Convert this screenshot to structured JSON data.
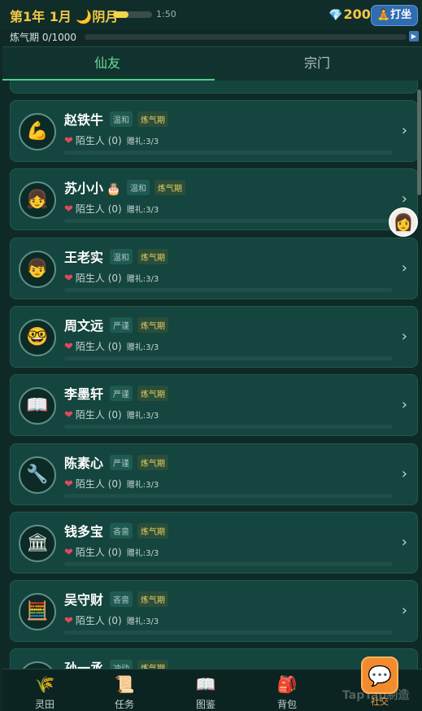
{
  "header": {
    "date": "第1年 1月",
    "moon_icon": "🌙",
    "moon_phase": "阴月",
    "time": "1:50",
    "time_progress": 0.4,
    "gems": "200",
    "gem_icon": "💎",
    "meditate_icon": "🧘",
    "meditate_label": "打坐"
  },
  "cultivation": {
    "label": "炼气期 0/1000",
    "progress": 0
  },
  "tabs": [
    {
      "label": "仙友",
      "active": true
    },
    {
      "label": "宗门",
      "active": false
    }
  ],
  "friends": [
    {
      "name": "赵铁牛",
      "avatar": "💪",
      "temper": "温和",
      "realm": "炼气期",
      "relation": "陌生人 (0)",
      "gift": "赠礼:3/3"
    },
    {
      "name": "苏小小",
      "avatar": "👧",
      "badge": "🎂",
      "temper": "温和",
      "realm": "炼气期",
      "relation": "陌生人 (0)",
      "gift": "赠礼:3/3"
    },
    {
      "name": "王老实",
      "avatar": "👦",
      "temper": "温和",
      "realm": "炼气期",
      "relation": "陌生人 (0)",
      "gift": "赠礼:3/3"
    },
    {
      "name": "周文远",
      "avatar": "🤓",
      "temper": "严谨",
      "realm": "炼气期",
      "relation": "陌生人 (0)",
      "gift": "赠礼:3/3"
    },
    {
      "name": "李墨轩",
      "avatar": "📖",
      "temper": "严谨",
      "realm": "炼气期",
      "relation": "陌生人 (0)",
      "gift": "赠礼:3/3"
    },
    {
      "name": "陈素心",
      "avatar": "🔧",
      "temper": "严谨",
      "realm": "炼气期",
      "relation": "陌生人 (0)",
      "gift": "赠礼:3/3"
    },
    {
      "name": "钱多宝",
      "avatar": "🏛",
      "temper": "吝啬",
      "realm": "炼气期",
      "relation": "陌生人 (0)",
      "gift": "赠礼:3/3"
    },
    {
      "name": "吴守财",
      "avatar": "🧮",
      "temper": "吝啬",
      "realm": "炼气期",
      "relation": "陌生人 (0)",
      "gift": "赠礼:3/3"
    },
    {
      "name": "孙一丞",
      "avatar": "🙂",
      "temper": "冲动",
      "realm": "炼气期",
      "relation": "",
      "gift": ""
    }
  ],
  "nav": [
    {
      "label": "灵田",
      "icon": "🌾"
    },
    {
      "label": "任务",
      "icon": "📜"
    },
    {
      "label": "图鉴",
      "icon": "📖"
    },
    {
      "label": "背包",
      "icon": "🎒"
    }
  ],
  "social": {
    "label": "社交",
    "icon": "💬"
  },
  "watermark": "TapTap制造"
}
